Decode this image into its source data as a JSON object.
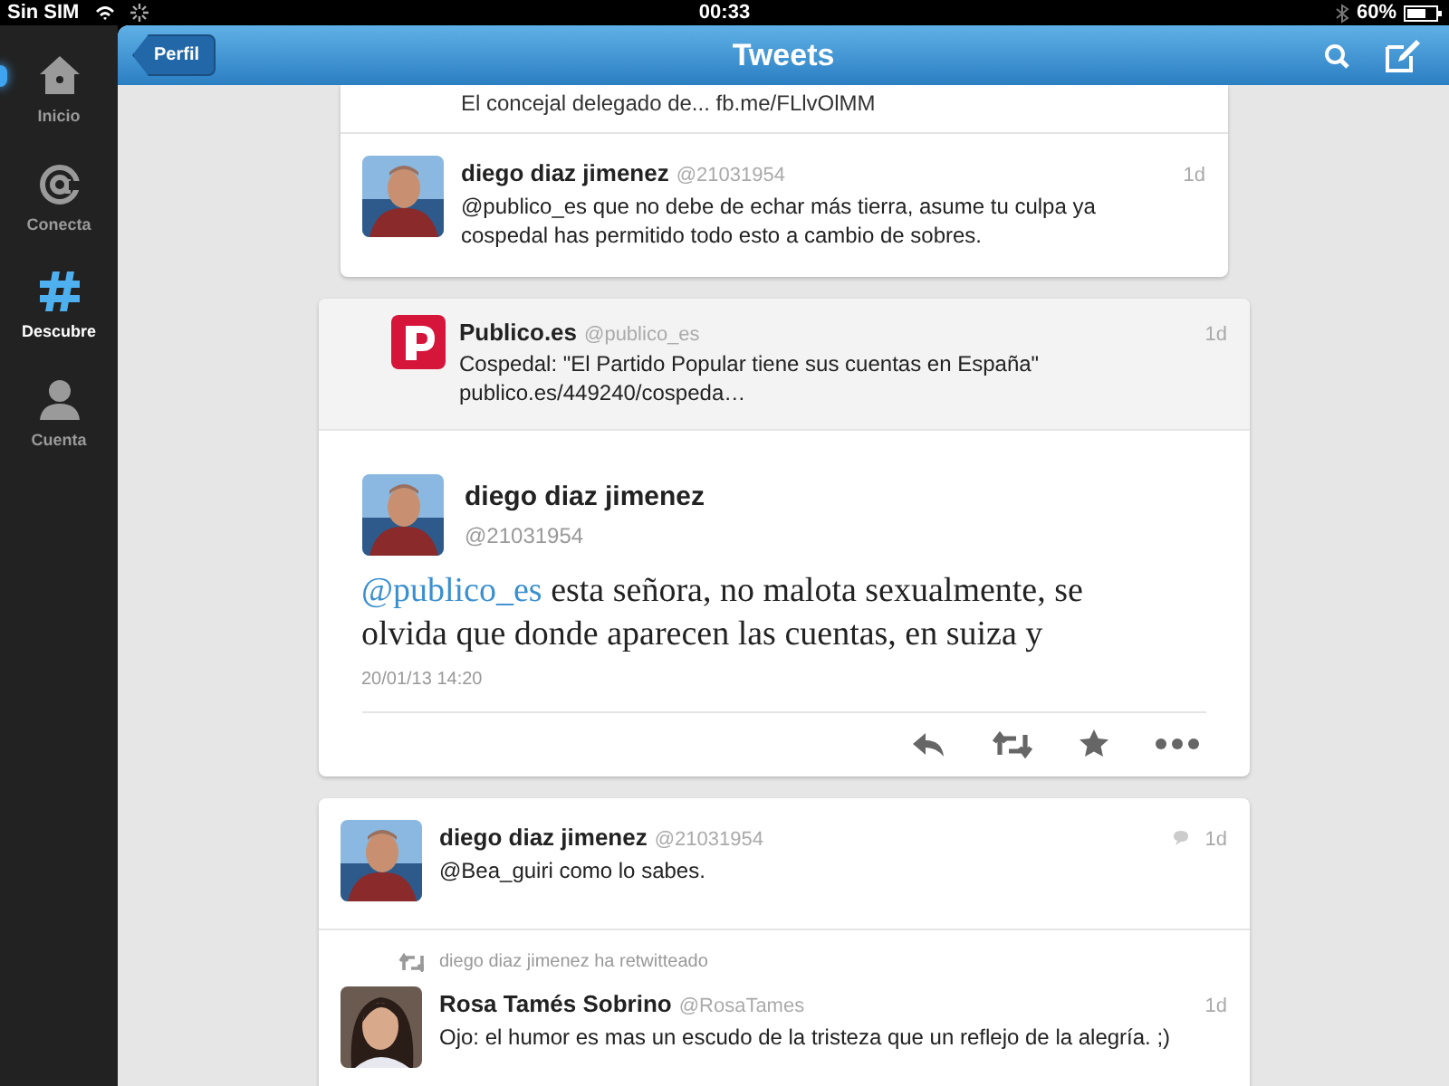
{
  "status_bar": {
    "carrier": "Sin SIM",
    "time": "00:33",
    "battery": "60%"
  },
  "sidebar": {
    "items": [
      {
        "label": "Inicio",
        "kind": "home",
        "selected": false,
        "unread": true
      },
      {
        "label": "Conecta",
        "kind": "at",
        "selected": false,
        "unread": false
      },
      {
        "label": "Descubre",
        "kind": "hash",
        "selected": true,
        "unread": false
      },
      {
        "label": "Cuenta",
        "kind": "person",
        "selected": false,
        "unread": false
      }
    ]
  },
  "nav_bar": {
    "back": "Perfil",
    "title": "Tweets"
  },
  "cards": [
    {
      "items": [
        {
          "kind": "fragment",
          "text": "El concejal delegado de... fb.me/FLlvOlMM"
        },
        {
          "kind": "tweet",
          "name": "diego diaz jimenez",
          "handle": "@21031954",
          "time": "1d",
          "conversation": false,
          "text": "@publico_es que no debe de echar más tierra, asume tu culpa ya cospedal has permitido todo esto a cambio de sobres."
        }
      ]
    },
    {
      "items": [
        {
          "kind": "quoted",
          "name": "Publico.es",
          "handle": "@publico_es",
          "time": "1d",
          "text": "Cospedal: \"El Partido Popular tiene sus cuentas en España\" publico.es/449240/cospeda…"
        },
        {
          "kind": "detail",
          "name": "diego diaz jimenez",
          "handle": "@21031954",
          "mention": "@publico_es",
          "text": "esta señora, no malota sexualmente, se olvida que donde aparecen las cuentas, en suiza y",
          "date": "20/01/13 14:20"
        }
      ]
    },
    {
      "items": [
        {
          "kind": "tweet",
          "name": "diego diaz jimenez",
          "handle": "@21031954",
          "time": "1d",
          "conversation": true,
          "text": "@Bea_guiri como lo sabes."
        },
        {
          "kind": "tweet",
          "retweeted_by": "diego diaz jimenez ha retwitteado",
          "name": "Rosa Tamés Sobrino",
          "handle": "@RosaTames",
          "time": "1d",
          "conversation": false,
          "text": "Ojo: el humor es mas un escudo de la tristeza que un reflejo de la alegría. ;)"
        }
      ]
    }
  ]
}
